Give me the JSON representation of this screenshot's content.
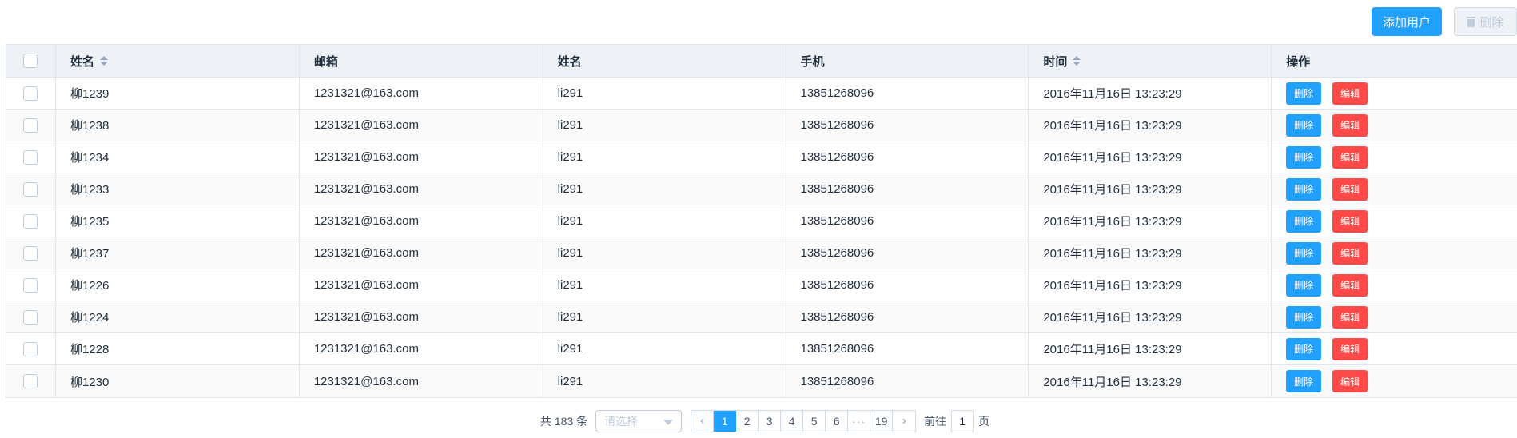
{
  "toolbar": {
    "add_label": "添加用户",
    "delete_label": "删除"
  },
  "table": {
    "columns": [
      "姓名",
      "邮箱",
      "姓名",
      "手机",
      "时间",
      "操作"
    ],
    "rows": [
      {
        "name": "柳1239",
        "email": "1231321@163.com",
        "alias": "li291",
        "phone": "13851268096",
        "time": "2016年11月16日 13:23:29"
      },
      {
        "name": "柳1238",
        "email": "1231321@163.com",
        "alias": "li291",
        "phone": "13851268096",
        "time": "2016年11月16日 13:23:29"
      },
      {
        "name": "柳1234",
        "email": "1231321@163.com",
        "alias": "li291",
        "phone": "13851268096",
        "time": "2016年11月16日 13:23:29"
      },
      {
        "name": "柳1233",
        "email": "1231321@163.com",
        "alias": "li291",
        "phone": "13851268096",
        "time": "2016年11月16日 13:23:29"
      },
      {
        "name": "柳1235",
        "email": "1231321@163.com",
        "alias": "li291",
        "phone": "13851268096",
        "time": "2016年11月16日 13:23:29"
      },
      {
        "name": "柳1237",
        "email": "1231321@163.com",
        "alias": "li291",
        "phone": "13851268096",
        "time": "2016年11月16日 13:23:29"
      },
      {
        "name": "柳1226",
        "email": "1231321@163.com",
        "alias": "li291",
        "phone": "13851268096",
        "time": "2016年11月16日 13:23:29"
      },
      {
        "name": "柳1224",
        "email": "1231321@163.com",
        "alias": "li291",
        "phone": "13851268096",
        "time": "2016年11月16日 13:23:29"
      },
      {
        "name": "柳1228",
        "email": "1231321@163.com",
        "alias": "li291",
        "phone": "13851268096",
        "time": "2016年11月16日 13:23:29"
      },
      {
        "name": "柳1230",
        "email": "1231321@163.com",
        "alias": "li291",
        "phone": "13851268096",
        "time": "2016年11月16日 13:23:29"
      }
    ],
    "row_actions": {
      "delete_label": "删除",
      "edit_label": "编辑"
    }
  },
  "pagination": {
    "total_label": "共 183 条",
    "page_size_placeholder": "请选择",
    "pages": [
      "1",
      "2",
      "3",
      "4",
      "5",
      "6",
      "···",
      "19"
    ],
    "current_page": "1",
    "goto_prefix": "前往",
    "goto_value": "1",
    "goto_suffix": "页"
  },
  "colors": {
    "primary": "#20a0ff",
    "danger": "#ff4949",
    "header_bg": "#eef1f6",
    "border": "#dfe6ec"
  }
}
